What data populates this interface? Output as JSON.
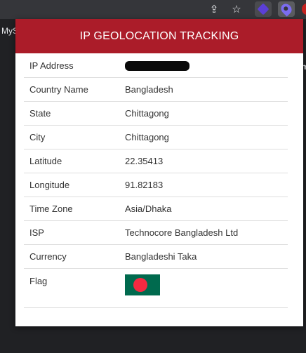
{
  "browser": {
    "bookmark_left": "MyS",
    "bookmark_right": "Gm"
  },
  "popup": {
    "title": "IP GEOLOCATION TRACKING",
    "rows": [
      {
        "label": "IP Address",
        "value": ""
      },
      {
        "label": "Country Name",
        "value": "Bangladesh"
      },
      {
        "label": "State",
        "value": "Chittagong"
      },
      {
        "label": "City",
        "value": "Chittagong"
      },
      {
        "label": "Latitude",
        "value": "22.35413"
      },
      {
        "label": "Longitude",
        "value": "91.82183"
      },
      {
        "label": "Time Zone",
        "value": "Asia/Dhaka"
      },
      {
        "label": "ISP",
        "value": "Technocore Bangladesh Ltd"
      },
      {
        "label": "Currency",
        "value": "Bangladeshi Taka"
      },
      {
        "label": "Flag",
        "value": ""
      }
    ],
    "flag_colors": {
      "field": "#006a4e",
      "disc": "#f42a41"
    },
    "header_color": "#ab1c29"
  }
}
